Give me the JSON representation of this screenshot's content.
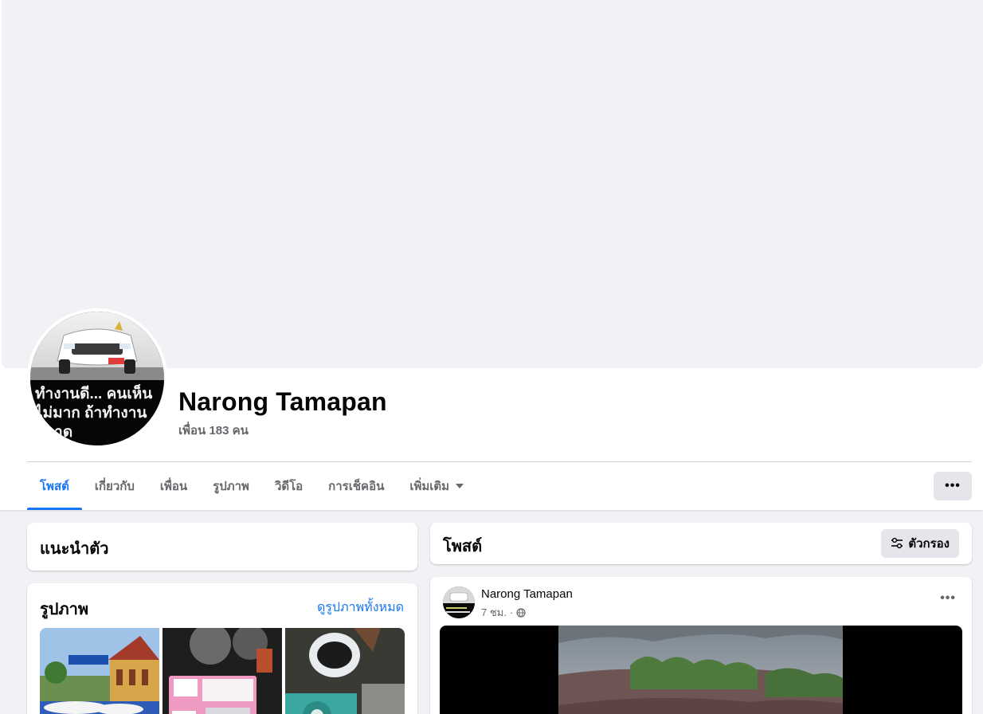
{
  "profile": {
    "name": "Narong Tamapan",
    "friends_text": "เพื่อน 183 คน",
    "avatar_caption": "ทำงานดี... คนเห็นไม่มาก ถ้าทำงานพลาด"
  },
  "tabs": [
    {
      "label": "โพสต์",
      "active": true
    },
    {
      "label": "เกี่ยวกับ"
    },
    {
      "label": "เพื่อน"
    },
    {
      "label": "รูปภาพ"
    },
    {
      "label": "วิดีโอ"
    },
    {
      "label": "การเช็คอิน"
    },
    {
      "label": "เพิ่มเติม"
    }
  ],
  "more_button_label": "•••",
  "intro": {
    "title": "แนะนำตัว"
  },
  "photos": {
    "title": "รูปภาพ",
    "see_all": "ดูรูปภาพทั้งหมด"
  },
  "posts": {
    "title": "โพสต์",
    "filter_label": "ตัวกรอง"
  },
  "post": {
    "author": "Narong Tamapan",
    "time": "7 ชม.",
    "separator": "·",
    "menu": "•••"
  },
  "colors": {
    "accent": "#1877f2",
    "background": "#f0f2f5",
    "secondary_text": "#65676b"
  }
}
